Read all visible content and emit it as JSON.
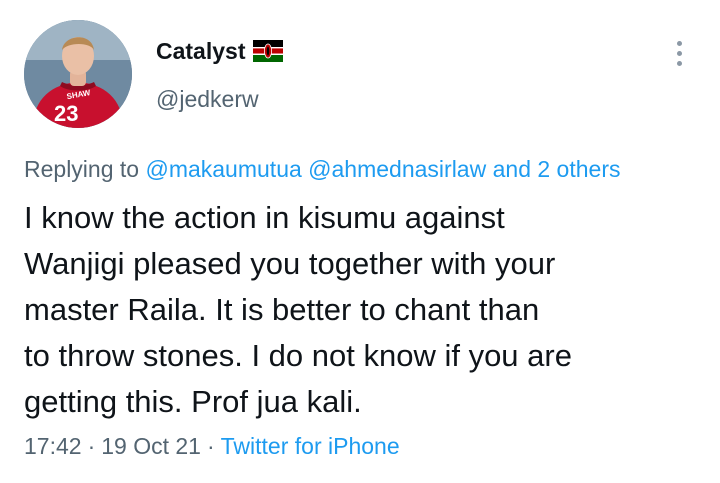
{
  "author": {
    "display_name": "Catalyst",
    "handle": "@jedkerw",
    "flag_icon": "kenya-flag-icon",
    "avatar": {
      "description_icon": "avatar-icon",
      "jersey_name": "SHAW",
      "jersey_number": "23"
    }
  },
  "more_icon": "more-options-icon",
  "reply_context": {
    "prefix": "Replying to",
    "mentions": [
      "@makaumutua",
      "@ahmednasirlaw"
    ],
    "and": "and",
    "others": "2 others"
  },
  "tweet": {
    "lines": [
      "I know the action in kisumu against",
      "Wanjigi pleased you together with your",
      "master Raila. It is better to chant than",
      "to throw stones. I do not know if you are",
      "getting this. Prof jua kali."
    ]
  },
  "meta": {
    "time": "17:42",
    "separator": "·",
    "date": "19 Oct 21",
    "source": "Twitter for iPhone"
  },
  "colors": {
    "link": "#1d9bf0",
    "secondary_text": "#536471",
    "primary_text": "#0f1419",
    "jersey_red": "#c8102e"
  }
}
